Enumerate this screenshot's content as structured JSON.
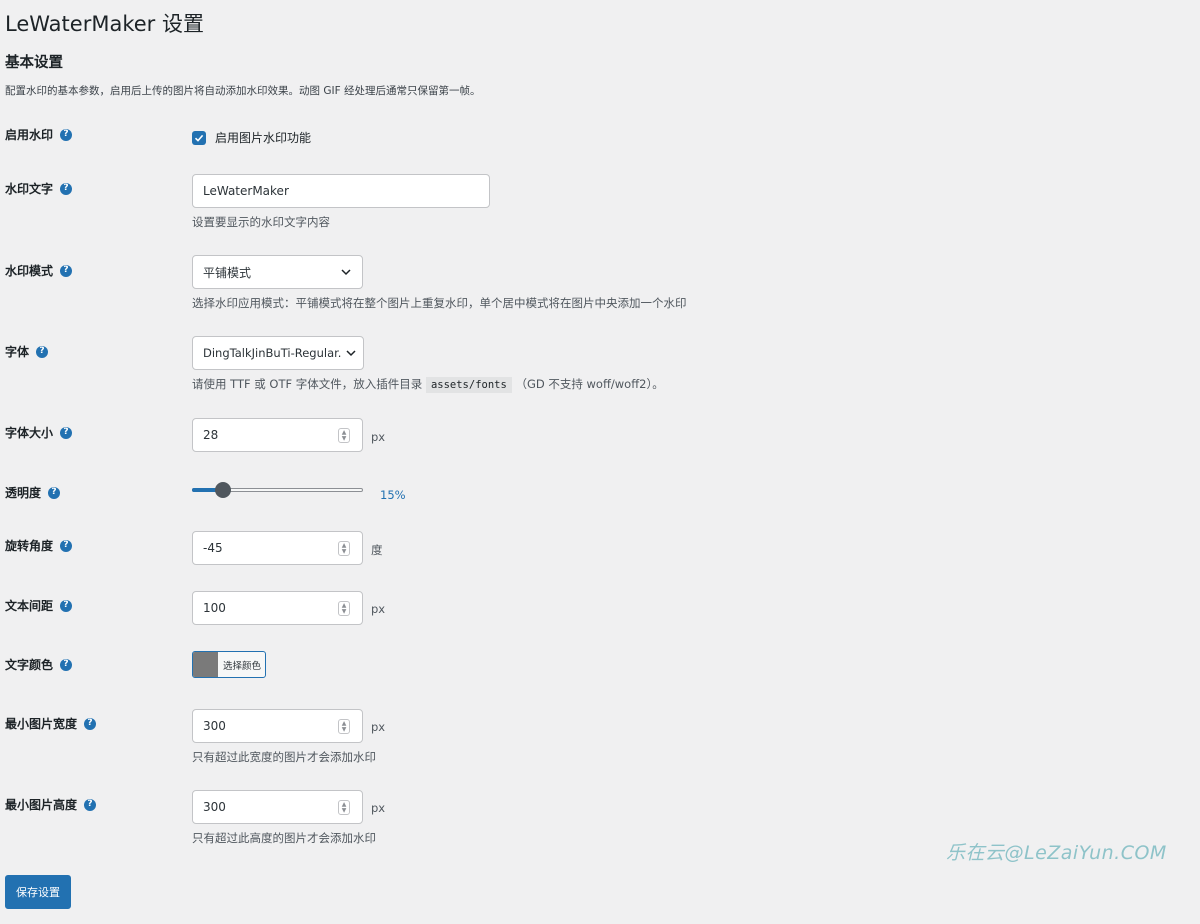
{
  "page": {
    "title": "LeWaterMaker 设置",
    "section_title": "基本设置",
    "section_desc": "配置水印的基本参数，启用后上传的图片将自动添加水印效果。动图 GIF 经处理后通常只保留第一帧。"
  },
  "fields": {
    "enable": {
      "label": "启用水印",
      "checkbox_label": "启用图片水印功能",
      "checked": true
    },
    "text": {
      "label": "水印文字",
      "value": "LeWaterMaker",
      "hint": "设置要显示的水印文字内容"
    },
    "mode": {
      "label": "水印模式",
      "value": "平铺模式",
      "hint": "选择水印应用模式：平铺模式将在整个图片上重复水印，单个居中模式将在图片中央添加一个水印"
    },
    "font": {
      "label": "字体",
      "value": "DingTalkJinBuTi-Regular.ttf",
      "hint_before": "请使用 TTF 或 OTF 字体文件，放入插件目录",
      "hint_code": "assets/fonts",
      "hint_after": "（GD 不支持 woff/woff2）。"
    },
    "font_size": {
      "label": "字体大小",
      "value": "28",
      "unit": "px"
    },
    "opacity": {
      "label": "透明度",
      "value_text": "15%",
      "value": 0.15
    },
    "rotation": {
      "label": "旋转角度",
      "value": "-45",
      "unit": "度"
    },
    "spacing": {
      "label": "文本间距",
      "value": "100",
      "unit": "px"
    },
    "color": {
      "label": "文字颜色",
      "button_label": "选择颜色",
      "swatch": "#7a7a7a"
    },
    "min_width": {
      "label": "最小图片宽度",
      "value": "300",
      "unit": "px",
      "hint": "只有超过此宽度的图片才会添加水印"
    },
    "min_height": {
      "label": "最小图片高度",
      "value": "300",
      "unit": "px",
      "hint": "只有超过此高度的图片才会添加水印"
    }
  },
  "actions": {
    "save_label": "保存设置"
  },
  "help_icon_glyph": "?",
  "watermark_text": "乐在云@LeZaiYun.COM",
  "colors": {
    "accent": "#2271b1",
    "background": "#f0f0f1"
  }
}
